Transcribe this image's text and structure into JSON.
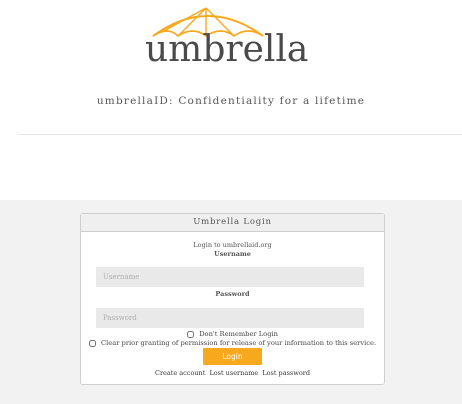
{
  "brand": {
    "wordmark": "umbrella",
    "accent_color": "#f7a81c",
    "tagline": "umbrellaID: Confidentiality for a lifetime"
  },
  "login": {
    "panel_title": "Umbrella Login",
    "intro": "Login to umbrellaid.org",
    "username_label": "Username",
    "username_placeholder": "Username",
    "username_value": "",
    "password_label": "Password",
    "password_placeholder": "Password",
    "password_value": "",
    "dont_remember_label": "Don't Remember Login",
    "clear_prior_label": "Clear prior granting of permission for release of your information to this service.",
    "login_button": "Login",
    "links": {
      "create_account": "Create account",
      "lost_username": "Lost username",
      "lost_password": "Lost password"
    }
  }
}
